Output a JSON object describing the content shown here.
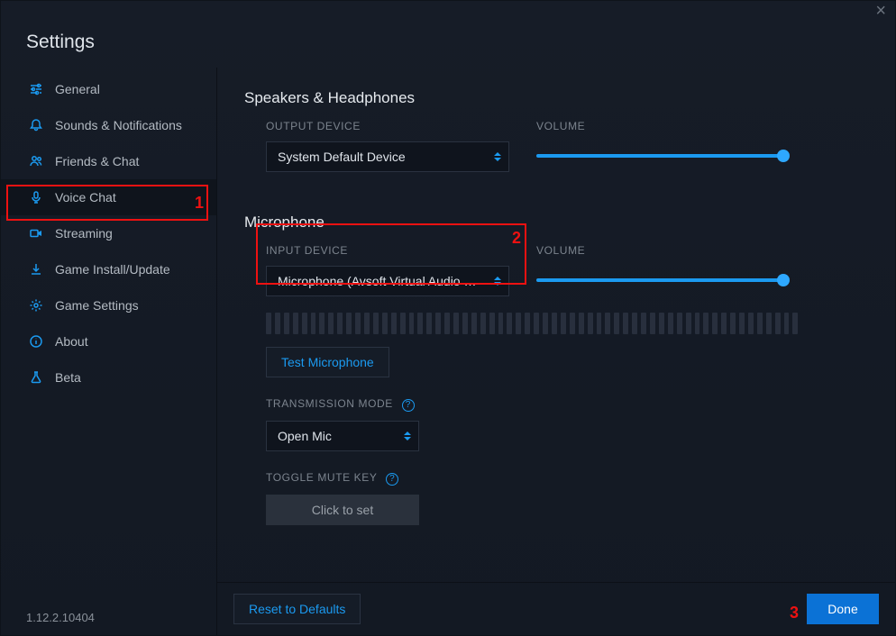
{
  "title": "Settings",
  "version": "1.12.2.10404",
  "sidebar": {
    "items": [
      {
        "label": "General"
      },
      {
        "label": "Sounds & Notifications"
      },
      {
        "label": "Friends & Chat"
      },
      {
        "label": "Voice Chat"
      },
      {
        "label": "Streaming"
      },
      {
        "label": "Game Install/Update"
      },
      {
        "label": "Game Settings"
      },
      {
        "label": "About"
      },
      {
        "label": "Beta"
      }
    ]
  },
  "speakers": {
    "section": "Speakers & Headphones",
    "output_label": "OUTPUT DEVICE",
    "output_value": "System Default Device",
    "volume_label": "VOLUME",
    "volume_pct": 100
  },
  "mic": {
    "section": "Microphone",
    "input_label": "INPUT DEVICE",
    "input_value": "Microphone (Avsoft Virtual Audio Device)",
    "volume_label": "VOLUME",
    "volume_pct": 100,
    "test_btn": "Test Microphone",
    "transmission_label": "TRANSMISSION MODE",
    "transmission_value": "Open Mic",
    "toggle_mute_label": "TOGGLE MUTE KEY",
    "toggle_mute_value": "Click to set"
  },
  "footer": {
    "reset": "Reset to Defaults",
    "done": "Done"
  },
  "annotations": {
    "n1": "1",
    "n2": "2",
    "n3": "3"
  }
}
